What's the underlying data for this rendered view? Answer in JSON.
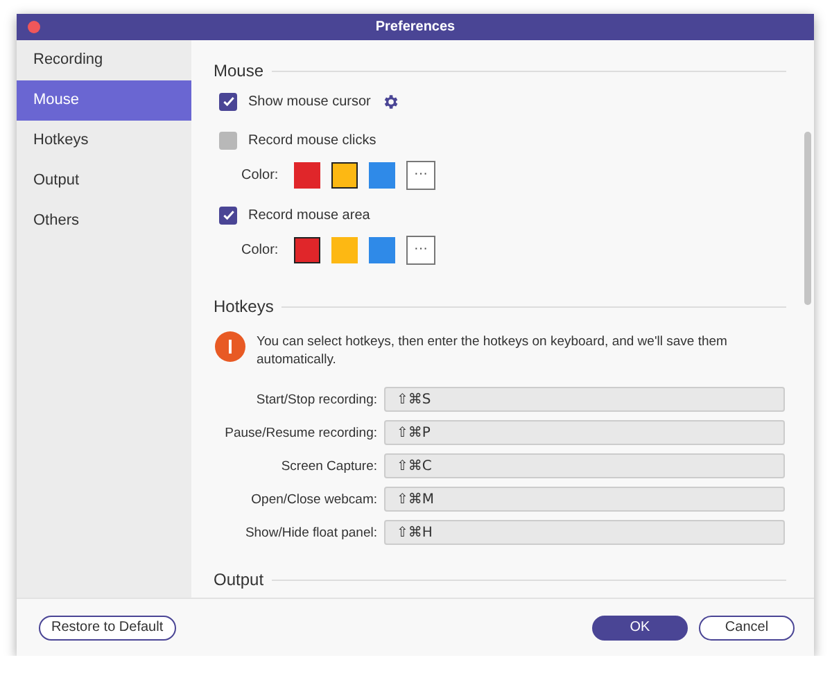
{
  "window": {
    "title": "Preferences"
  },
  "sidebar": {
    "items": [
      {
        "label": "Recording",
        "selected": false
      },
      {
        "label": "Mouse",
        "selected": true
      },
      {
        "label": "Hotkeys",
        "selected": false
      },
      {
        "label": "Output",
        "selected": false
      },
      {
        "label": "Others",
        "selected": false
      }
    ]
  },
  "mouse": {
    "heading": "Mouse",
    "options": [
      {
        "kind": "checkbox",
        "label": "Show mouse cursor",
        "checked": true,
        "disabled": false,
        "settings": true
      },
      {
        "kind": "checkbox",
        "label": "Record mouse clicks",
        "checked": false,
        "disabled": true,
        "settings": false
      },
      {
        "kind": "colors",
        "label": "Color:",
        "swatches": [
          {
            "color": "#e0262a",
            "selected": false
          },
          {
            "color": "#fdb813",
            "selected": true
          },
          {
            "color": "#2f8ae8",
            "selected": false
          }
        ],
        "more": "···"
      },
      {
        "kind": "checkbox",
        "label": "Record mouse area",
        "checked": true,
        "disabled": false,
        "settings": false
      },
      {
        "kind": "colors",
        "label": "Color:",
        "swatches": [
          {
            "color": "#e0262a",
            "selected": true
          },
          {
            "color": "#fdb813",
            "selected": false
          },
          {
            "color": "#2f8ae8",
            "selected": false
          }
        ],
        "more": "···"
      }
    ]
  },
  "hotkeys": {
    "heading": "Hotkeys",
    "info": "You can select hotkeys, then enter the hotkeys on keyboard, and we'll save them automatically.",
    "fields": [
      {
        "label": "Start/Stop recording:",
        "value": "⇧⌘S"
      },
      {
        "label": "Pause/Resume recording:",
        "value": "⇧⌘P"
      },
      {
        "label": "Screen Capture:",
        "value": "⇧⌘C"
      },
      {
        "label": "Open/Close webcam:",
        "value": "⇧⌘M"
      },
      {
        "label": "Show/Hide float panel:",
        "value": "⇧⌘H"
      }
    ]
  },
  "output": {
    "heading": "Output"
  },
  "footer": {
    "restore": "Restore to Default",
    "ok": "OK",
    "cancel": "Cancel"
  }
}
